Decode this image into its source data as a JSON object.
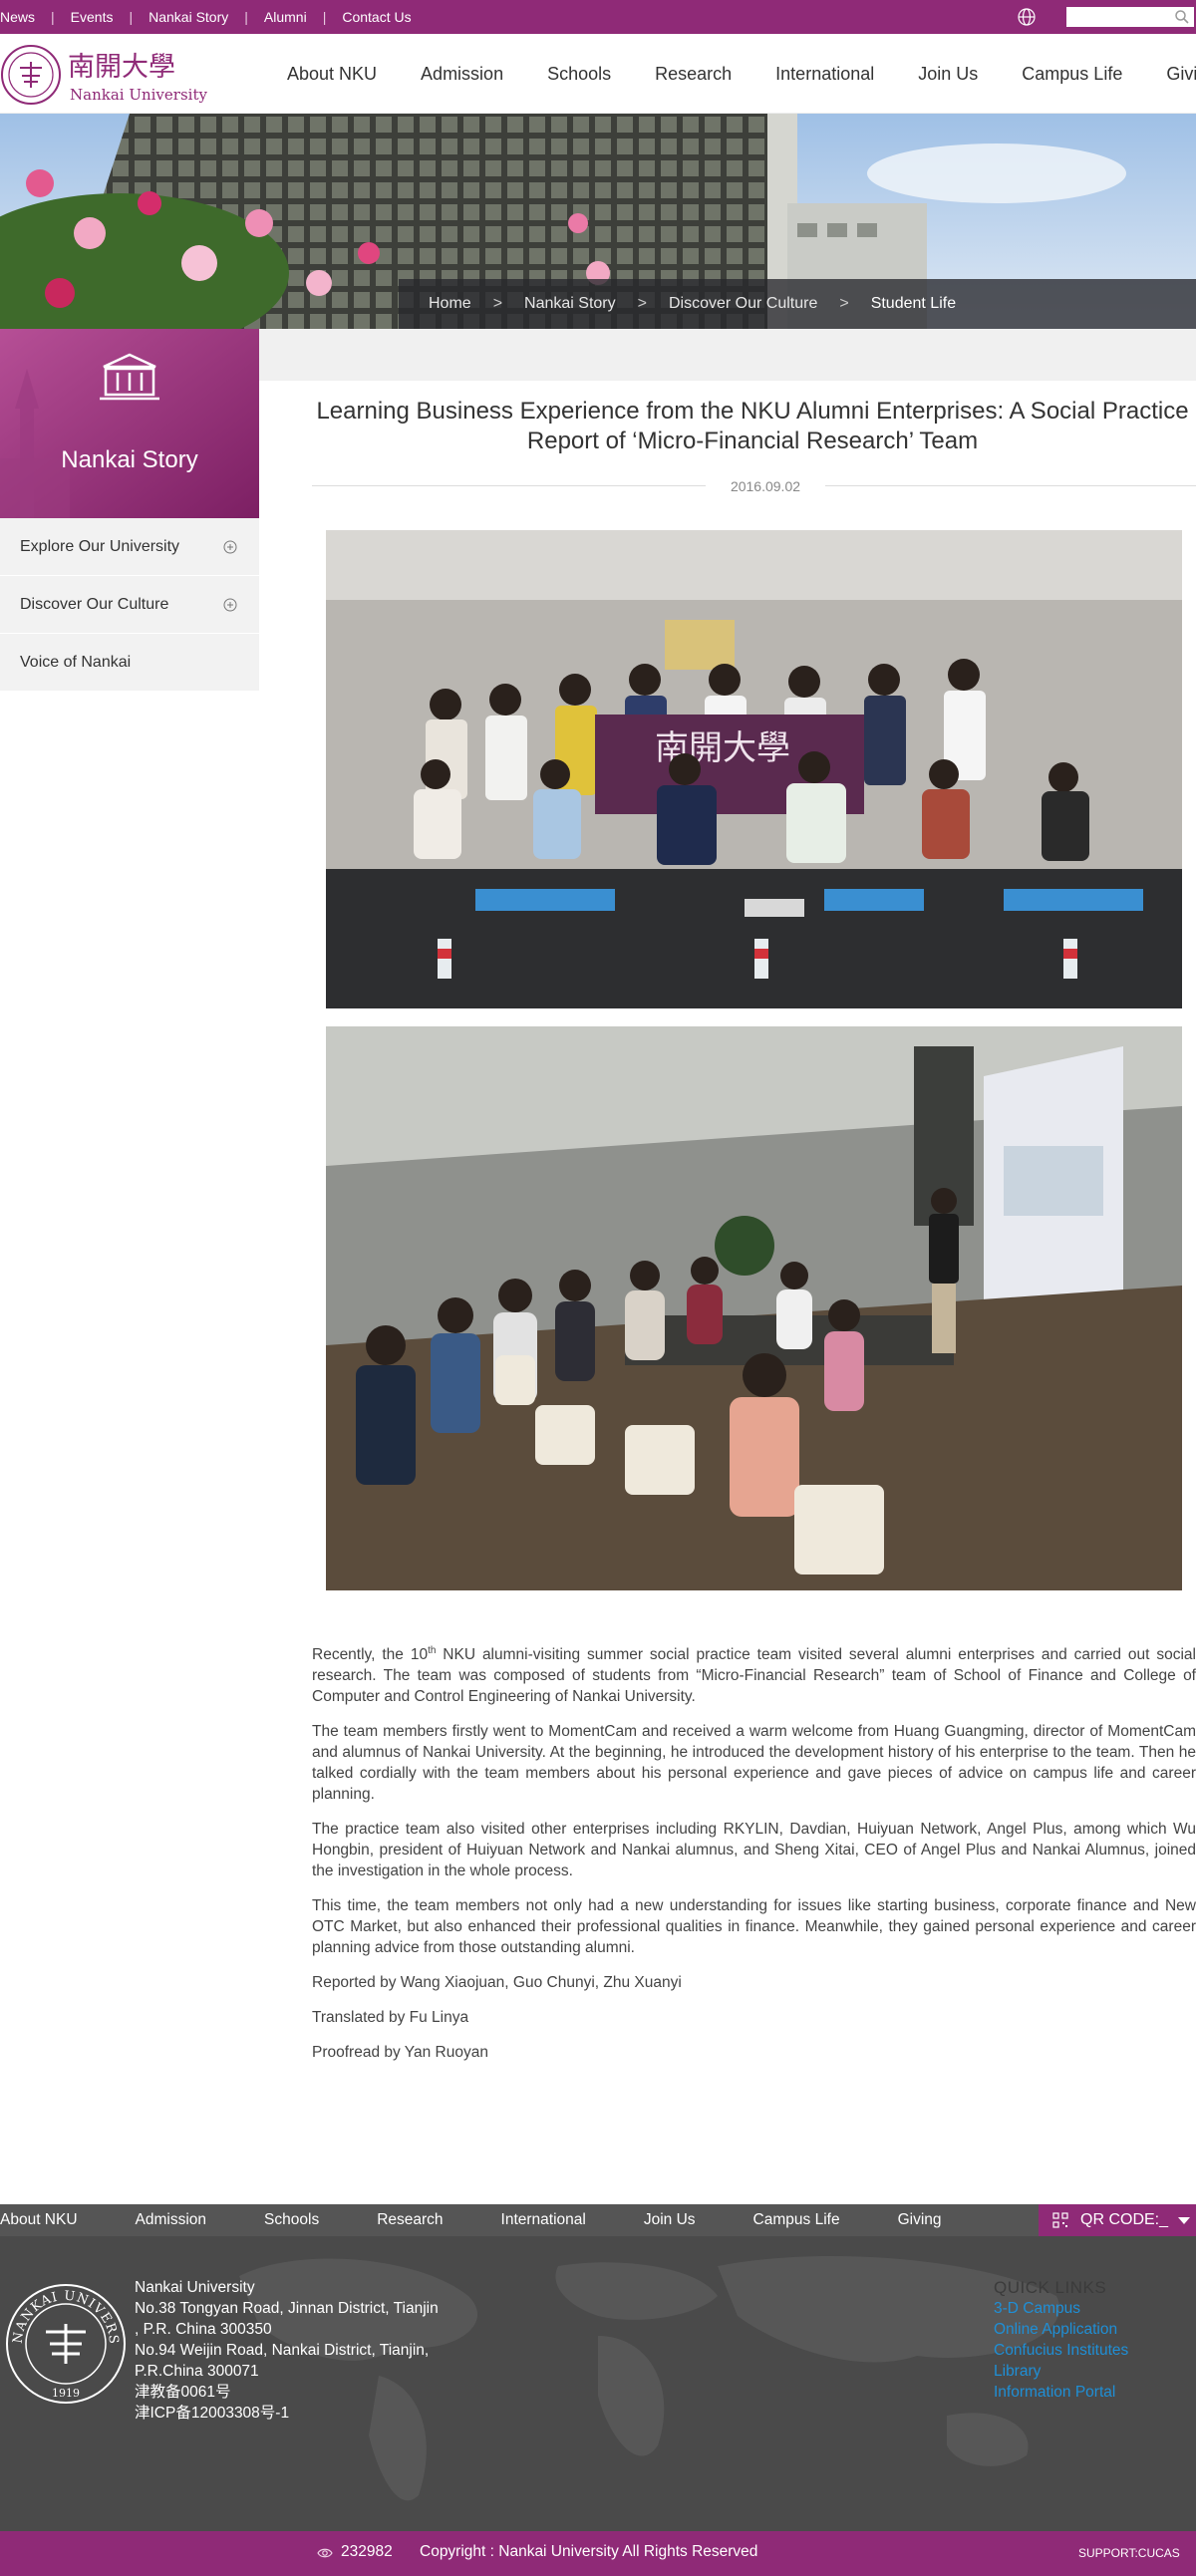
{
  "topbar": {
    "links": [
      "News",
      "Events",
      "Nankai Story",
      "Alumni",
      "Contact Us"
    ],
    "search_placeholder": ""
  },
  "header": {
    "logo_cn": "南開大學",
    "logo_en": "Nankai University",
    "nav": [
      "About NKU",
      "Admission",
      "Schools",
      "Research",
      "International",
      "Join Us",
      "Campus Life",
      "Giving"
    ]
  },
  "breadcrumb": {
    "items": [
      "Home",
      "Nankai Story",
      "Discover Our Culture",
      "Student Life"
    ],
    "separator": ">"
  },
  "sidebar": {
    "title": "Nankai Story",
    "items": [
      {
        "label": "Explore Our University",
        "expandable": true
      },
      {
        "label": "Discover Our Culture",
        "expandable": true
      },
      {
        "label": "Voice of Nankai",
        "expandable": false
      }
    ]
  },
  "article": {
    "title": "Learning Business Experience from the NKU Alumni Enterprises: A Social Practice Report of ‘Micro-Financial Research’ Team",
    "date": "2016.09.02",
    "p1_pre": "Recently, the 10",
    "p1_sup": "th",
    "p1_post": " NKU alumni-visiting summer social practice team visited several alumni enterprises and carried out social research. The team was composed of students from “Micro-Financial Research” team of School of Finance and College of Computer and Control Engineering of Nankai University.",
    "p2": "The team members firstly went to MomentCam and received a warm welcome from Huang Guangming, director of MomentCam and alumnus of Nankai University. At the beginning, he introduced the development history of his enterprise to the team. Then he talked cordially with the team members about his personal experience and gave pieces of advice on campus life and career planning.",
    "p3": "The practice team also visited other enterprises including RKYLIN, Davdian, Huiyuan Network, Angel Plus, among which Wu Hongbin, president of Huiyuan Network and Nankai alumnus, and Sheng Xitai, CEO of Angel Plus and Nankai Alumnus, joined the investigation in the whole process.",
    "p4": "This time, the team members not only had a new understanding for issues like starting business, corporate finance and New OTC Market, but also enhanced their professional qualities in finance. Meanwhile, they gained personal experience and career planning advice from those outstanding alumni.",
    "reported": "Reported by Wang Xiaojuan, Guo Chunyi, Zhu Xuanyi",
    "translated": "Translated by Fu Linya",
    "proofread": "Proofread by Yan Ruoyan"
  },
  "photos": {
    "banner_text": "南開大學"
  },
  "footer": {
    "nav": [
      "About NKU",
      "Admission",
      "Schools",
      "Research",
      "International",
      "Join Us",
      "Campus Life",
      "Giving"
    ],
    "qr_label": "QR CODE:_",
    "seal_text": "NANKAI UNIVERSITY",
    "seal_year": "1919",
    "address": [
      "Nankai University",
      "No.38 Tongyan Road, Jinnan District, Tianjin",
      ", P.R. China 300350",
      "No.94 Weijin Road,  Nankai District, Tianjin,",
      "P.R.China  300071",
      "津教备0061号",
      "津ICP备12003308号-1"
    ],
    "quick_links_title": "QUICK LINKS",
    "quick_links": [
      "3-D Campus",
      "Online Application",
      "Confucius Institutes",
      "Library",
      "Information Portal"
    ],
    "visit_count": "232982",
    "copyright": "Copyright : Nankai University All Rights Reserved",
    "support": "SUPPORT:CUCAS"
  },
  "colors": {
    "brand_purple": "#8f2a77",
    "footer_gray": "#4a4a4a",
    "link_blue": "#1f8fd6"
  }
}
